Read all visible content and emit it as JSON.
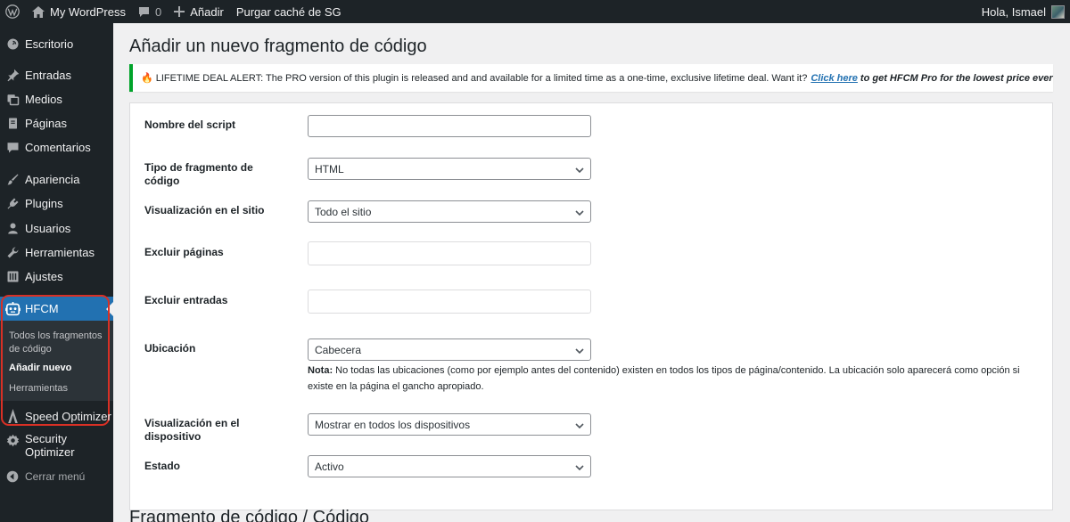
{
  "adminbar": {
    "site_name": "My WordPress",
    "comments_count": "0",
    "add_new": "Añadir",
    "purge_cache": "Purgar caché de SG",
    "greeting": "Hola, Ismael"
  },
  "sidebar": {
    "items": [
      {
        "label": "Escritorio",
        "icon": "dashboard-icon"
      },
      {
        "label": "Entradas",
        "icon": "pin-icon"
      },
      {
        "label": "Medios",
        "icon": "media-icon"
      },
      {
        "label": "Páginas",
        "icon": "pages-icon"
      },
      {
        "label": "Comentarios",
        "icon": "comment-icon"
      },
      {
        "label": "Apariencia",
        "icon": "brush-icon"
      },
      {
        "label": "Plugins",
        "icon": "plugin-icon"
      },
      {
        "label": "Usuarios",
        "icon": "user-icon"
      },
      {
        "label": "Herramientas",
        "icon": "wrench-icon"
      },
      {
        "label": "Ajustes",
        "icon": "settings-icon"
      },
      {
        "label": "HFCM",
        "icon": "robot-icon"
      },
      {
        "label": "Speed Optimizer",
        "icon": "speed-icon"
      },
      {
        "label": "Security Optimizer",
        "icon": "gear-icon"
      },
      {
        "label": "Cerrar menú",
        "icon": "collapse-icon"
      }
    ],
    "submenu": [
      {
        "label": "Todos los fragmentos de código"
      },
      {
        "label": "Añadir nuevo"
      },
      {
        "label": "Herramientas"
      }
    ]
  },
  "page": {
    "title": "Añadir un nuevo fragmento de código",
    "notice": {
      "text": "LIFETIME DEAL ALERT: The PRO version of this plugin is released and and available for a limited time as a one-time, exclusive lifetime deal. Want it?",
      "link": "Click here",
      "tail": "to get HFCM Pro for the lowest price ever"
    },
    "form": {
      "script_name_label": "Nombre del script",
      "script_name_value": "",
      "snippet_type_label": "Tipo de fragmento de código",
      "snippet_type_value": "HTML",
      "site_display_label": "Visualización en el sitio",
      "site_display_value": "Todo el sitio",
      "exclude_pages_label": "Excluir páginas",
      "exclude_posts_label": "Excluir entradas",
      "location_label": "Ubicación",
      "location_value": "Cabecera",
      "note_bold": "Nota:",
      "note_text": "No todas las ubicaciones (como por ejemplo antes del contenido) existen en todos los tipos de página/contenido. La ubicación solo aparecerá como opción si existe en la página el gancho apropiado.",
      "device_display_label": "Visualización en el dispositivo",
      "device_display_value": "Mostrar en todos los dispositivos",
      "status_label": "Estado",
      "status_value": "Activo"
    },
    "section_heading": "Fragmento de código / Código"
  },
  "colors": {
    "accent": "#2271b1",
    "highlight": "#d93025",
    "notice_border": "#00a32a",
    "adminbar_bg": "#1d2327"
  }
}
